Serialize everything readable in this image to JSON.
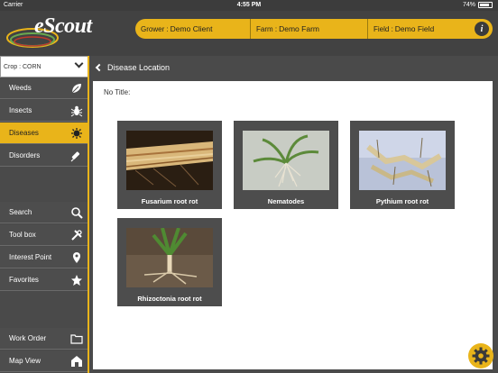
{
  "status_bar": {
    "carrier": "Carrier",
    "time": "4:55 PM",
    "battery": "74%"
  },
  "header": {
    "app_name": "eScout",
    "grower_label": "Grower :",
    "grower_value": "Demo Client",
    "farm_label": "Farm :",
    "farm_value": "Demo Farm",
    "field_label": "Field :",
    "field_value": "Demo Field",
    "info_glyph": "i"
  },
  "sidebar": {
    "crop_label": "Crop : CORN",
    "items": [
      {
        "label": "Weeds",
        "icon": "leaf-icon"
      },
      {
        "label": "Insects",
        "icon": "bug-icon"
      },
      {
        "label": "Diseases",
        "icon": "virus-icon",
        "active": true
      },
      {
        "label": "Disorders",
        "icon": "syringe-icon"
      },
      {
        "label": "Search",
        "icon": "search-icon"
      },
      {
        "label": "Tool box",
        "icon": "tools-icon"
      },
      {
        "label": "Interest Point",
        "icon": "map-pin-icon"
      },
      {
        "label": "Favorites",
        "icon": "star-icon"
      },
      {
        "label": "Work Order",
        "icon": "folder-icon"
      },
      {
        "label": "Map View",
        "icon": "barn-icon"
      }
    ]
  },
  "main": {
    "title": "Disease Location",
    "section_title": "No Title:",
    "tiles": [
      {
        "caption": "Fusarium root rot"
      },
      {
        "caption": "Nematodes"
      },
      {
        "caption": "Pythium root rot"
      },
      {
        "caption": "Rhizoctonia root rot"
      }
    ]
  },
  "colors": {
    "accent": "#e9b41a",
    "dark": "#4a4a4a",
    "header": "#424242"
  }
}
